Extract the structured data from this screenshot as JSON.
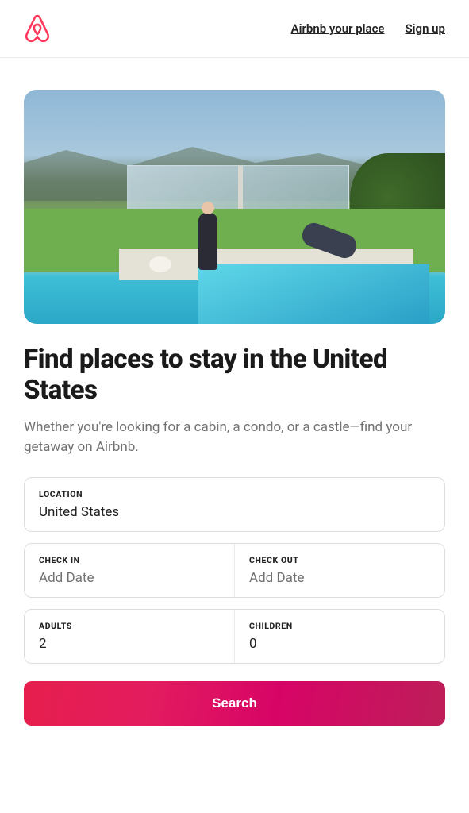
{
  "header": {
    "host_link": "Airbnb your place",
    "signup_link": "Sign up"
  },
  "hero": {
    "alt": "Two people by a swimming pool in front of a mirrored glass house with mountains behind"
  },
  "page": {
    "title": "Find places to stay in the United States",
    "subtitle": "Whether you're looking for a cabin, a condo, or a castle—find your getaway on Airbnb."
  },
  "search": {
    "location": {
      "label": "LOCATION",
      "value": "United States"
    },
    "check_in": {
      "label": "CHECK IN",
      "placeholder": "Add Date"
    },
    "check_out": {
      "label": "CHECK OUT",
      "placeholder": "Add Date"
    },
    "adults": {
      "label": "ADULTS",
      "value": "2"
    },
    "children": {
      "label": "CHILDREN",
      "value": "0"
    },
    "button": "Search"
  },
  "colors": {
    "brand": "#FF385C",
    "text_muted": "#717171",
    "border": "#dddddd"
  }
}
